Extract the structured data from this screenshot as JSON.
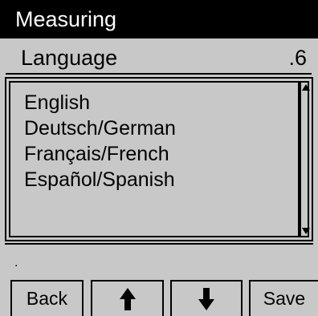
{
  "title": "Measuring",
  "header": {
    "label": "Language",
    "code": ".6"
  },
  "languages": [
    "English",
    "Deutsch/German",
    "Français/French",
    "Español/Spanish"
  ],
  "status_text": ".",
  "buttons": {
    "back": "Back",
    "up_icon": "arrow-up-icon",
    "down_icon": "arrow-down-icon",
    "save": "Save"
  },
  "colors": {
    "background": "#c8c8c8",
    "titlebar": "#000000",
    "title_text": "#ffffff"
  }
}
